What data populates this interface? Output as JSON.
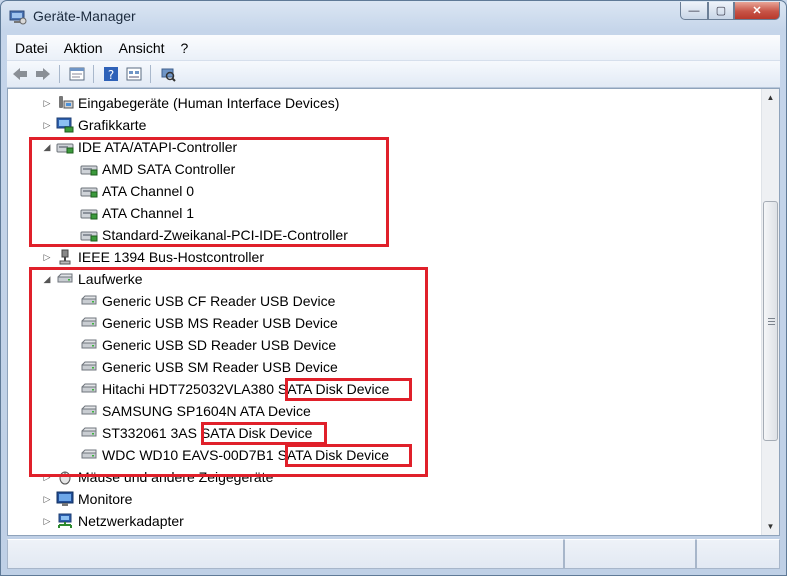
{
  "window": {
    "title": "Geräte-Manager",
    "minimize": "—",
    "maximize": "▢",
    "close": "✕"
  },
  "menu": [
    "Datei",
    "Aktion",
    "Ansicht",
    "?"
  ],
  "toolbar": {
    "icons": [
      "back-icon",
      "forward-icon",
      "properties-icon",
      "help-icon",
      "show-hide-icon",
      "scan-hardware-icon"
    ]
  },
  "tree": [
    {
      "label": "Eingabegeräte (Human Interface Devices)",
      "level": 0,
      "state": "collapsed",
      "icon": "hid-icon"
    },
    {
      "label": "Grafikkarte",
      "level": 0,
      "state": "collapsed",
      "icon": "display-adapter-icon"
    },
    {
      "label": "IDE ATA/ATAPI-Controller",
      "level": 0,
      "state": "expanded",
      "icon": "ide-controller-icon"
    },
    {
      "label": "AMD SATA Controller",
      "level": 1,
      "icon": "ide-controller-icon"
    },
    {
      "label": "ATA Channel 0",
      "level": 1,
      "icon": "ide-controller-icon"
    },
    {
      "label": "ATA Channel 1",
      "level": 1,
      "icon": "ide-controller-icon"
    },
    {
      "label": "Standard-Zweikanal-PCI-IDE-Controller",
      "level": 1,
      "icon": "ide-controller-icon"
    },
    {
      "label": "IEEE 1394 Bus-Hostcontroller",
      "level": 0,
      "state": "collapsed",
      "icon": "firewire-icon"
    },
    {
      "label": "Laufwerke",
      "level": 0,
      "state": "expanded",
      "icon": "disk-drive-icon"
    },
    {
      "label": "Generic USB CF Reader USB Device",
      "level": 1,
      "icon": "disk-drive-icon"
    },
    {
      "label": "Generic USB MS Reader USB Device",
      "level": 1,
      "icon": "disk-drive-icon"
    },
    {
      "label": "Generic USB SD Reader USB Device",
      "level": 1,
      "icon": "disk-drive-icon"
    },
    {
      "label": "Generic USB SM Reader USB Device",
      "level": 1,
      "icon": "disk-drive-icon"
    },
    {
      "label": "Hitachi HDT725032VLA380 SATA Disk Device",
      "level": 1,
      "icon": "disk-drive-icon"
    },
    {
      "label": "SAMSUNG SP1604N ATA Device",
      "level": 1,
      "icon": "disk-drive-icon"
    },
    {
      "label": "ST332061 3AS SATA Disk Device",
      "level": 1,
      "icon": "disk-drive-icon"
    },
    {
      "label": "WDC WD10 EAVS-00D7B1 SATA Disk Device",
      "level": 1,
      "icon": "disk-drive-icon"
    },
    {
      "label": "Mäuse und andere Zeigegeräte",
      "level": 0,
      "state": "collapsed",
      "icon": "mouse-icon"
    },
    {
      "label": "Monitore",
      "level": 0,
      "state": "collapsed",
      "icon": "monitor-icon"
    },
    {
      "label": "Netzwerkadapter",
      "level": 0,
      "state": "collapsed",
      "icon": "network-adapter-icon"
    }
  ],
  "colors": {
    "highlight": "#e0202a"
  }
}
